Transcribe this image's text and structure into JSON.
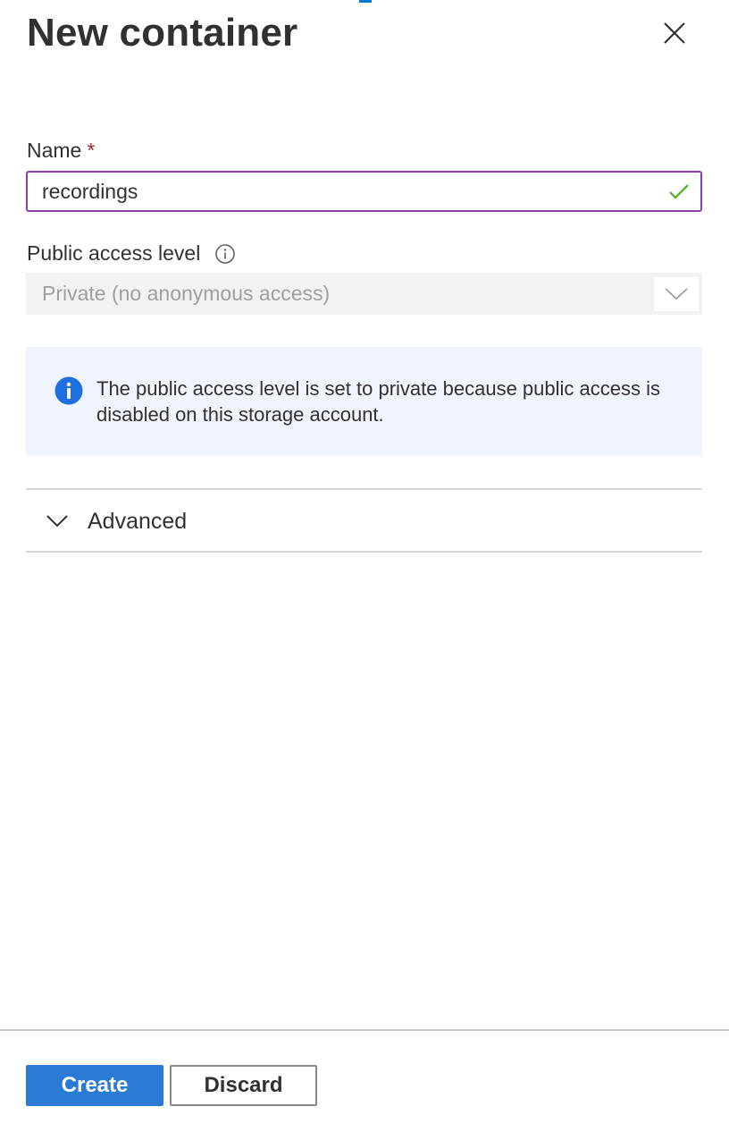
{
  "panel": {
    "title": "New container",
    "close_icon": "close-icon"
  },
  "name_field": {
    "label": "Name",
    "required_marker": "*",
    "value": "recordings",
    "valid_icon": "checkmark-icon",
    "border_color": "#8a3ea6"
  },
  "public_access": {
    "label": "Public access level",
    "info_icon": "info-circle-icon",
    "selected_value": "Private (no anonymous access)",
    "disabled": true
  },
  "info_message": {
    "icon": "info-filled-icon",
    "text": "The public access level is set to private because public access is disabled on this storage account."
  },
  "advanced": {
    "label": "Advanced",
    "expanded": false
  },
  "footer": {
    "create_label": "Create",
    "discard_label": "Discard"
  },
  "colors": {
    "primary": "#2b7bd6",
    "required": "#a4262c",
    "valid": "#5cb338",
    "info_bg": "#eff4fd",
    "info_icon": "#1f6fe0"
  }
}
